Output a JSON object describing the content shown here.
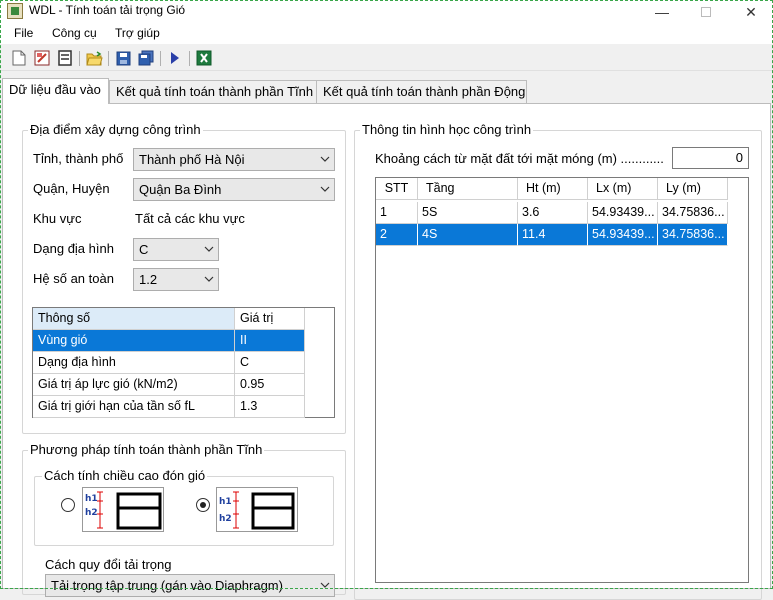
{
  "window": {
    "title": "WDL - Tính toán tải trọng Gió"
  },
  "menu": {
    "items": [
      "File",
      "Công cụ",
      "Trợ giúp"
    ]
  },
  "toolbar": {
    "icons": [
      "new-file-icon",
      "open-pdf-icon",
      "form-icon",
      "open-folder-icon",
      "save-icon",
      "save-all-icon",
      "run-icon",
      "excel-icon"
    ]
  },
  "tabs": [
    {
      "label": "Dữ liệu đầu vào",
      "active": true
    },
    {
      "label": "Kết quả tính toán thành phần Tĩnh",
      "active": false
    },
    {
      "label": "Kết quả tính toán thành phần Động",
      "active": false
    }
  ],
  "location": {
    "title": "Địa điểm xây dựng công trình",
    "province_label": "Tỉnh, thành phố",
    "province_value": "Thành phố Hà Nội",
    "district_label": "Quận, Huyện",
    "district_value": "Quận Ba Đình",
    "area_label": "Khu vực",
    "area_value": "Tất cả các khu vực",
    "terrain_label": "Dạng địa hình",
    "terrain_value": "C",
    "safety_label": "Hệ số an toàn",
    "safety_value": "1.2",
    "param_table": {
      "headers": [
        "Thông số",
        "Giá trị"
      ],
      "rows": [
        {
          "name": "Vùng gió",
          "value": "II",
          "selected": true
        },
        {
          "name": "Dạng địa hình",
          "value": "C",
          "selected": false
        },
        {
          "name": "Giá trị áp lực gió (kN/m2)",
          "value": "0.95",
          "selected": false
        },
        {
          "name": "Giá trị giới hạn của tần số fL",
          "value": "1.3",
          "selected": false
        }
      ]
    }
  },
  "static_method": {
    "title": "Phương pháp tính toán thành phần Tĩnh",
    "height_group_title": "Cách tính chiều cao đón gió",
    "options": [
      {
        "labels": [
          "h1",
          "h2"
        ],
        "checked": false
      },
      {
        "labels": [
          "h1",
          "h2"
        ],
        "checked": true
      }
    ],
    "conversion_label": "Cách quy đổi tải trọng",
    "conversion_value": "Tải trọng tập trung (gán vào Diaphragm)"
  },
  "geometry": {
    "title": "Thông tin hình học công trình",
    "distance_label": "Khoảng cách từ mặt đất tới mặt móng (m) ............",
    "distance_value": "0",
    "table": {
      "headers": [
        "STT",
        "Tầng",
        "Ht (m)",
        "Lx (m)",
        "Ly (m)"
      ],
      "rows": [
        {
          "cells": [
            "1",
            "5S",
            "3.6",
            "54.93439...",
            "34.75836..."
          ],
          "selected": false
        },
        {
          "cells": [
            "2",
            "4S",
            "11.4",
            "54.93439...",
            "34.75836..."
          ],
          "selected": true
        }
      ]
    }
  }
}
